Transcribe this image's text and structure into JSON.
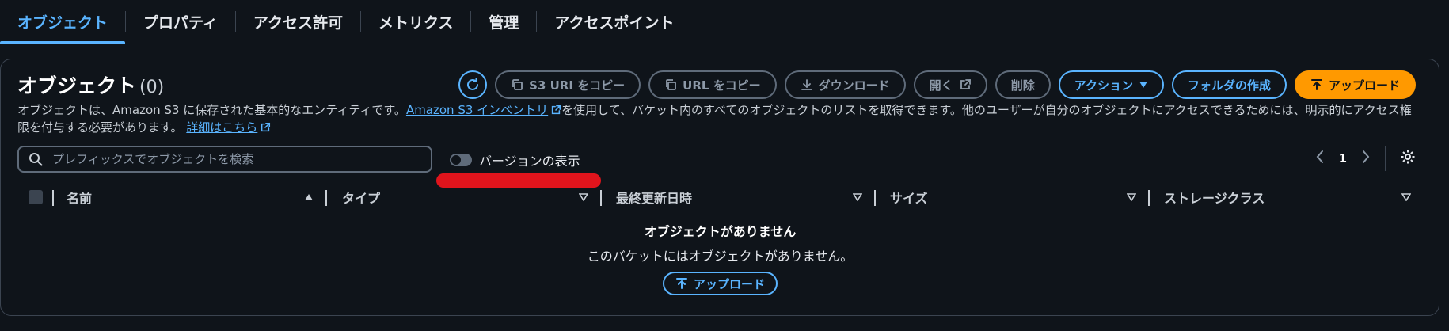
{
  "tabs": [
    {
      "label": "オブジェクト",
      "active": true
    },
    {
      "label": "プロパティ"
    },
    {
      "label": "アクセス許可"
    },
    {
      "label": "メトリクス"
    },
    {
      "label": "管理"
    },
    {
      "label": "アクセスポイント"
    }
  ],
  "panel": {
    "title": "オブジェクト",
    "count": "(0)",
    "description_before": "オブジェクトは、Amazon S3 に保存された基本的なエンティティです。",
    "inventory_link": "Amazon S3 インベントリ",
    "description_middle": "を使用して、バケット内のすべてのオブジェクトのリストを取得できます。他のユーザーが自分のオブジェクトにアクセスできるためには、明示的にアクセス権限を付与する必要があります。",
    "details_link": "詳細はこちら"
  },
  "actions": {
    "copy_s3_uri": "S3 URI をコピー",
    "copy_url": "URL をコピー",
    "download": "ダウンロード",
    "open": "開く",
    "delete": "削除",
    "action_menu": "アクション",
    "create_folder": "フォルダの作成",
    "upload": "アップロード"
  },
  "search": {
    "placeholder": "プレフィックスでオブジェクトを検索"
  },
  "versions_toggle": {
    "label": "バージョンの表示",
    "on": false
  },
  "pagination": {
    "current_page": "1"
  },
  "table": {
    "columns": [
      "名前",
      "タイプ",
      "最終更新日時",
      "サイズ",
      "ストレージクラス"
    ],
    "rows": []
  },
  "empty_state": {
    "title": "オブジェクトがありません",
    "message": "このバケットにはオブジェクトがありません。",
    "upload_button": "アップロード"
  },
  "colors": {
    "background": "#0f141a",
    "accent": "#5ab4ff",
    "primary": "#ff9900",
    "annotation": "#e0141c"
  }
}
